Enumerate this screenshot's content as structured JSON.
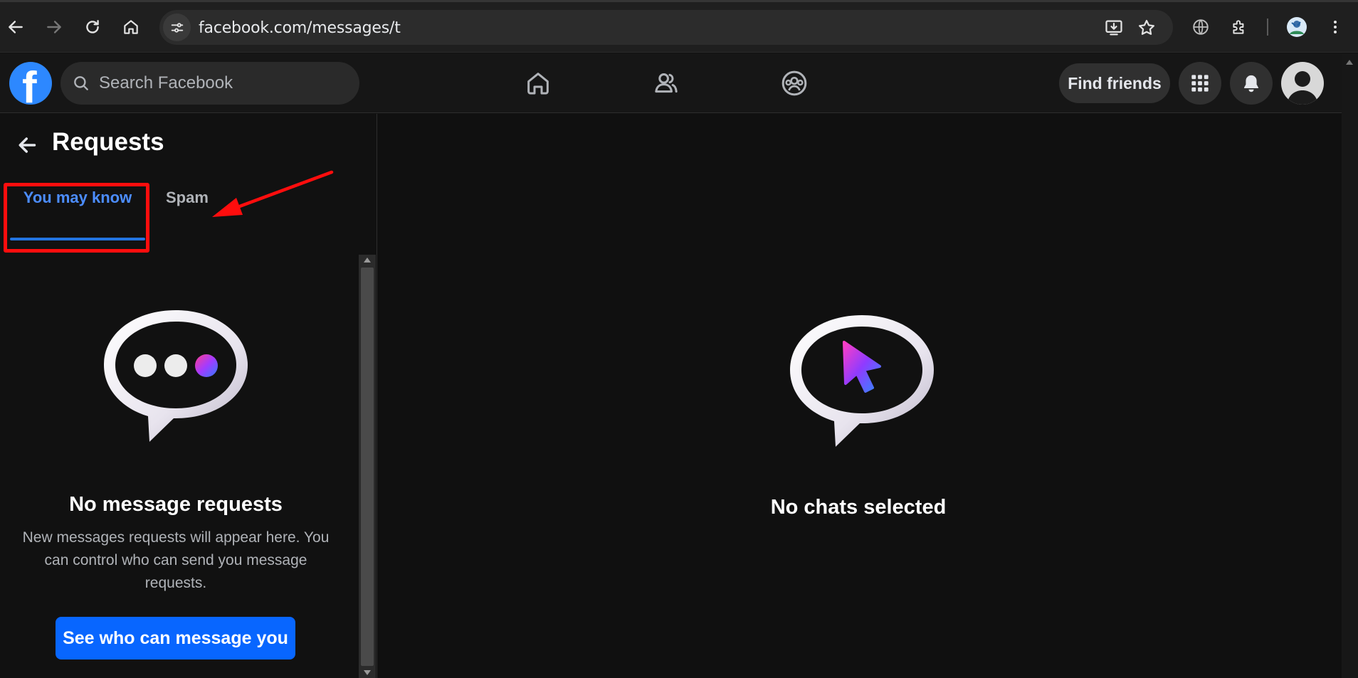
{
  "browser": {
    "url": "facebook.com/messages/t"
  },
  "header": {
    "logo_letter": "f",
    "search_placeholder": "Search Facebook",
    "find_friends_label": "Find friends"
  },
  "requests": {
    "title": "Requests",
    "tabs": [
      {
        "label": "You may know",
        "active": true
      },
      {
        "label": "Spam",
        "active": false
      }
    ],
    "empty_title": "No message requests",
    "empty_description": "New messages requests will appear here. You can control who can send you message requests.",
    "cta_label": "See who can message you"
  },
  "main": {
    "empty_title": "No chats selected"
  },
  "colors": {
    "accent_blue": "#0866ff",
    "tab_active": "#4c8dff",
    "annotation_red": "#ff0d0d",
    "background": "#101010"
  }
}
